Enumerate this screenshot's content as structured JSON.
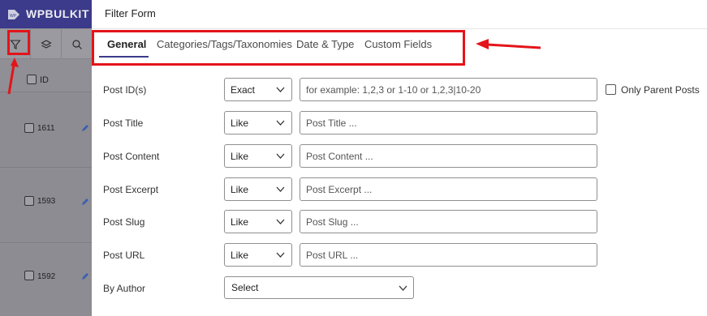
{
  "background_app": {
    "brand": "WPBULKIT",
    "header_id": "ID",
    "rows": [
      {
        "id": "1611"
      },
      {
        "id": "1593"
      },
      {
        "id": "1592"
      }
    ],
    "toolbar_icons": [
      "filter-icon",
      "layers-icon",
      "search-icon"
    ]
  },
  "modal": {
    "title": "Filter Form",
    "tabs": [
      {
        "label": "General",
        "active": true
      },
      {
        "label": "Categories/Tags/Taxonomies",
        "active": false
      },
      {
        "label": "Date & Type",
        "active": false
      },
      {
        "label": "Custom Fields",
        "active": false
      }
    ],
    "fields": [
      {
        "label": "Post ID(s)",
        "operator": "Exact",
        "placeholder": "for example: 1,2,3 or 1-10 or 1,2,3|10-20"
      },
      {
        "label": "Post Title",
        "operator": "Like",
        "placeholder": "Post Title ..."
      },
      {
        "label": "Post Content",
        "operator": "Like",
        "placeholder": "Post Content ..."
      },
      {
        "label": "Post Excerpt",
        "operator": "Like",
        "placeholder": "Post Excerpt ..."
      },
      {
        "label": "Post Slug",
        "operator": "Like",
        "placeholder": "Post Slug ..."
      },
      {
        "label": "Post URL",
        "operator": "Like",
        "placeholder": "Post URL ..."
      }
    ],
    "only_parent_posts": {
      "label": "Only Parent Posts",
      "checked": false
    },
    "author": {
      "label": "By Author",
      "value": "Select"
    }
  },
  "colors": {
    "accent": "#3c3a8a",
    "highlight": "#e3141a"
  }
}
